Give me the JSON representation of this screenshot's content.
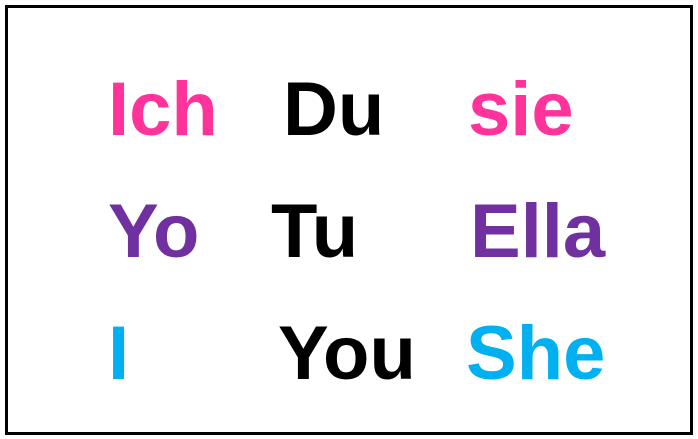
{
  "rows": [
    {
      "words": [
        {
          "text": "Ich",
          "color": "#ff3399"
        },
        {
          "text": "Du",
          "color": "#000000"
        },
        {
          "text": "sie",
          "color": "#ff3399"
        }
      ]
    },
    {
      "words": [
        {
          "text": "Yo",
          "color": "#7030a0"
        },
        {
          "text": "Tu",
          "color": "#000000"
        },
        {
          "text": "Ella",
          "color": "#7030a0"
        }
      ]
    },
    {
      "words": [
        {
          "text": "I",
          "color": "#00b0f0"
        },
        {
          "text": "You",
          "color": "#000000"
        },
        {
          "text": "She",
          "color": "#00b0f0"
        }
      ]
    }
  ]
}
